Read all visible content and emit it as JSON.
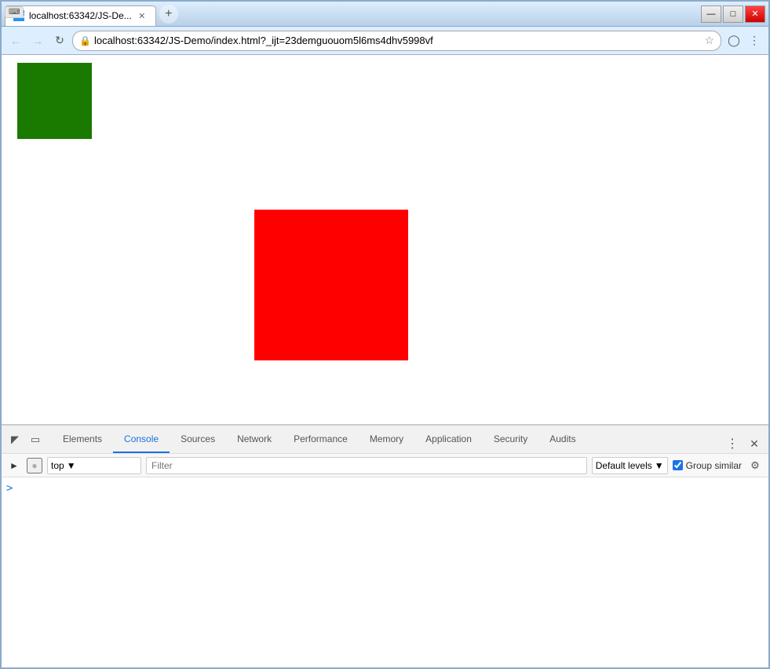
{
  "window": {
    "title": "localhost:63342/JS-De...",
    "favicon_text": "WS",
    "controls": {
      "minimize": "—",
      "maximize": "□",
      "close": "✕"
    }
  },
  "address_bar": {
    "url": "localhost:63342/JS-Demo/index.html?_ijt=23demguouom5l6ms4dhv5998vf",
    "back_disabled": true,
    "forward_disabled": true
  },
  "webpage": {
    "green_box": "visible",
    "red_box": "visible"
  },
  "devtools": {
    "tabs": [
      {
        "id": "elements",
        "label": "Elements",
        "active": false
      },
      {
        "id": "console",
        "label": "Console",
        "active": true
      },
      {
        "id": "sources",
        "label": "Sources",
        "active": false
      },
      {
        "id": "network",
        "label": "Network",
        "active": false
      },
      {
        "id": "performance",
        "label": "Performance",
        "active": false
      },
      {
        "id": "memory",
        "label": "Memory",
        "active": false
      },
      {
        "id": "application",
        "label": "Application",
        "active": false
      },
      {
        "id": "security",
        "label": "Security",
        "active": false
      },
      {
        "id": "audits",
        "label": "Audits",
        "active": false
      }
    ],
    "console": {
      "context": "top",
      "filter_placeholder": "Filter",
      "levels_label": "Default levels",
      "group_similar_label": "Group similar",
      "group_similar_checked": true
    }
  }
}
